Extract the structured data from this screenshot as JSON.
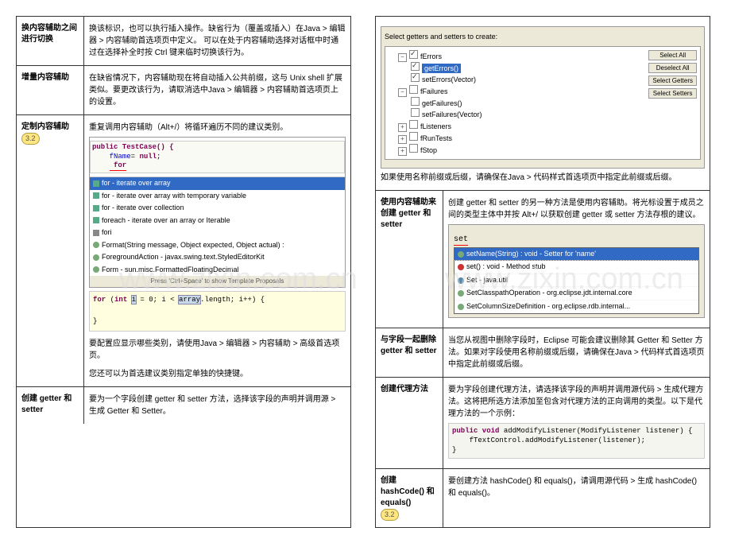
{
  "watermark": "www.zixin.com.cn",
  "p1": {
    "r1": {
      "t": "换内容辅助之间进行切换",
      "b": "换该标识，也可以执行插入操作。缺省行为（覆盖或插入）在Java > 编辑器 > 内容辅助首选项页中定义。\n可以在处于内容辅助选择对话框中时通过在选择补全时按 Ctrl 键来临时切换该行为。"
    },
    "r2": {
      "t": "增量内容辅助",
      "b": "在缺省情况下，内容辅助现在将自动插入公共前缀，这与 Unix shell 扩展类似。要更改该行为，请取消选中Java > 编辑器 > 内容辅助首选项页上的设置。"
    },
    "r3": {
      "t": "定制内容辅助",
      "badge": "3.2",
      "b": "重复调用内容辅助（Alt+/）将循环遍历不同的建议类别。",
      "code": [
        "public TestCase() {",
        "    fName= null;",
        "    for"
      ],
      "tmpl": [
        "for - iterate over array",
        "for - iterate over array with temporary variable",
        "for - iterate over collection",
        "foreach - iterate over an array or Iterable",
        "fori",
        "Format(String message, Object expected, Object actual) :",
        "ForegroundAction - javax.swing.text.StyledEditorKit",
        "Form - sun.misc.FormattedFloatingDecimal"
      ],
      "tmplfoot": "Press 'Ctrl+Space' to show Template Proposals",
      "forcode": "for (int i = 0; i < array.length; i++) {\n\n}",
      "b2": "要配置应显示哪些类别，请使用Java > 编辑器 > 内容辅助 > 高级首选项页。",
      "b3": "您还可以为首选建议类别指定单独的快捷键。"
    },
    "r4": {
      "t": "创建 getter 和 setter",
      "b": "要为一个字段创建 getter 和 setter\n方法，选择该字段的声明并调用源 > 生成 Getter 和 Setter。"
    }
  },
  "p2": {
    "r0": {
      "caption": "Select getters and setters to create:",
      "tree": [
        {
          "lvl": 1,
          "exp": "-",
          "ck": true,
          "txt": "fErrors"
        },
        {
          "lvl": 2,
          "ck": true,
          "txt": "getErrors()",
          "sel": true
        },
        {
          "lvl": 2,
          "ck": true,
          "txt": "setErrors(Vector)"
        },
        {
          "lvl": 1,
          "exp": "-",
          "ck": false,
          "txt": "fFailures"
        },
        {
          "lvl": 2,
          "ck": false,
          "txt": "getFailures()"
        },
        {
          "lvl": 2,
          "ck": false,
          "txt": "setFailures(Vector)"
        },
        {
          "lvl": 1,
          "exp": "+",
          "ck": false,
          "txt": "fListeners"
        },
        {
          "lvl": 1,
          "exp": "+",
          "ck": false,
          "txt": "fRunTests"
        },
        {
          "lvl": 1,
          "exp": "+",
          "ck": false,
          "txt": "fStop"
        }
      ],
      "btns": [
        "Select All",
        "Deselect All",
        "Select Getters",
        "Select Setters"
      ],
      "note": "如果使用名称前缀或后缀，请确保在Java > 代码样式首选项页中指定此前缀或后缀。"
    },
    "r1": {
      "t": "使用内容辅助来创建 getter 和 setter",
      "b": "创建 getter 和 setter\n的另一种方法是使用内容辅助。将光标设置于成员之间的类型主体中并按 Alt+/ 以获取创建 getter 或 setter 方法存根的建议。",
      "input": "set",
      "popup": [
        "setName(String) : void - Setter for 'name'",
        "set() : void - Method stub",
        "Set - java.util",
        "SetClasspathOperation - org.eclipse.jdt.internal.core",
        "SetColumnSizeDefinition - org.eclipse.rdb.internal..."
      ]
    },
    "r2": {
      "t": "与字段一起删除 getter 和 setter",
      "b": "当您从视图中删除字段时，Eclipse 可能会建议删除其 Getter 和 Setter 方法。如果对字段使用名称前缀或后缀，请确保在Java > 代码样式首选项页中指定此前缀或后缀。"
    },
    "r3": {
      "t": "创建代理方法",
      "b": "要为字段创建代理方法，请选择该字段的声明并调用源代码 > 生成代理方法。这将把所选方法添加至包含对代理方法的正向调用的类型。以下是代理方法的一个示例：",
      "code": [
        "public void addModifyListener(ModifyListener listener) {",
        "    fTextControl.addModifyListener(listener);",
        "}"
      ]
    },
    "r4": {
      "t": "创建 hashCode() 和 equals()",
      "badge": "3.2",
      "b": "要创建方法 hashCode() 和 equals()，请调用源代码 > 生成 hashCode() 和 equals()。"
    }
  }
}
